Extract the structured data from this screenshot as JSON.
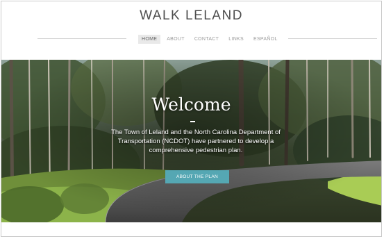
{
  "site": {
    "title": "WALK LELAND"
  },
  "nav": {
    "items": [
      {
        "label": "HOME",
        "active": true
      },
      {
        "label": "ABOUT"
      },
      {
        "label": "CONTACT"
      },
      {
        "label": "LINKS"
      },
      {
        "label": "ESPAÑOL"
      }
    ]
  },
  "hero": {
    "heading": "Welcome",
    "intro": "The Town of Leland and the North Carolina Department of Transportation (NCDOT) have partnered to develop a comprehensive pedestrian plan.",
    "cta_label": "ABOUT THE PLAN"
  },
  "colors": {
    "accent": "#55a7b3",
    "title": "#4d4d4d",
    "nav": "#9a9a9a"
  }
}
